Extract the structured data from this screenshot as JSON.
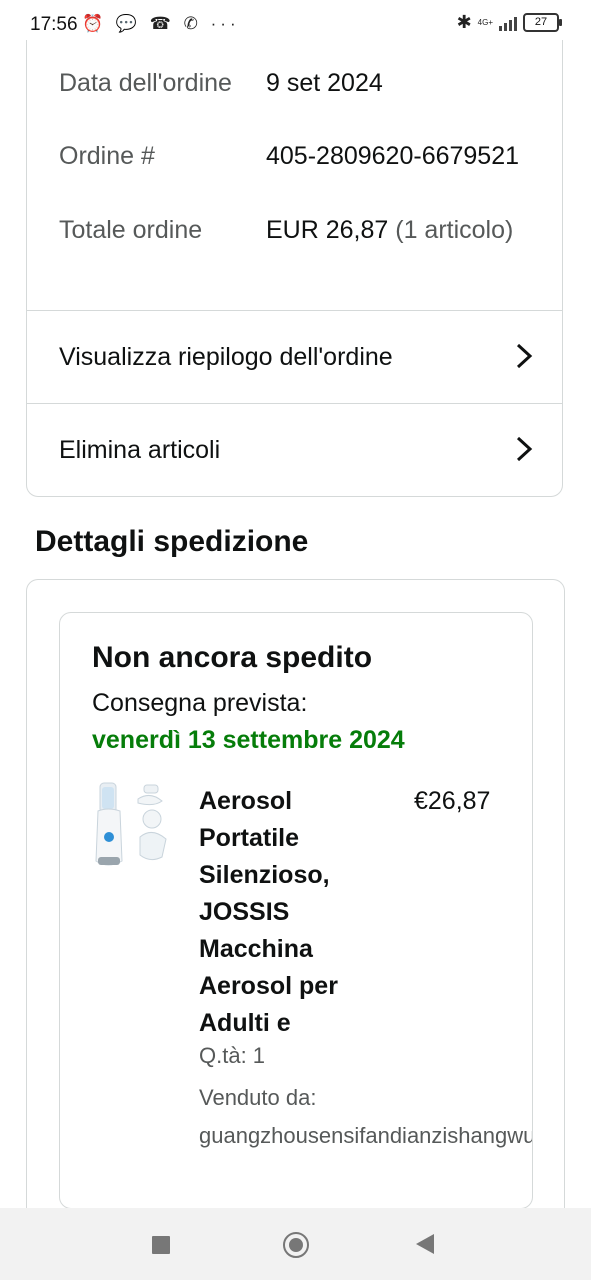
{
  "status_bar": {
    "time": "17:56",
    "left_icons": "⏰ 💬 ☎ ✆ ···",
    "network": "4G+",
    "battery": "27"
  },
  "order": {
    "date_label": "Data dell'ordine",
    "date_value": "9 set 2024",
    "number_label": "Ordine #",
    "number_value": "405-2809620-6679521",
    "total_label": "Totale ordine",
    "total_value": "EUR 26,87",
    "total_count": "(1 articolo)",
    "view_summary": "Visualizza riepilogo dell'ordine",
    "delete_items": "Elimina articoli"
  },
  "shipping": {
    "section_title": "Dettagli spedizione",
    "status": "Non ancora spedito",
    "expected_label": "Consegna prevista:",
    "expected_date": "venerdì 13 settembre 2024",
    "delivery_color": "#067d0a",
    "product": {
      "name": "Aerosol Portatile Silenzioso, JOSSIS Macchina Aerosol per Adulti e",
      "price": "€26,87",
      "qty": "Q.tà: 1",
      "sold_by_label": "Venduto da:",
      "seller": "guangzhousensifandianzishangwuyo"
    }
  }
}
